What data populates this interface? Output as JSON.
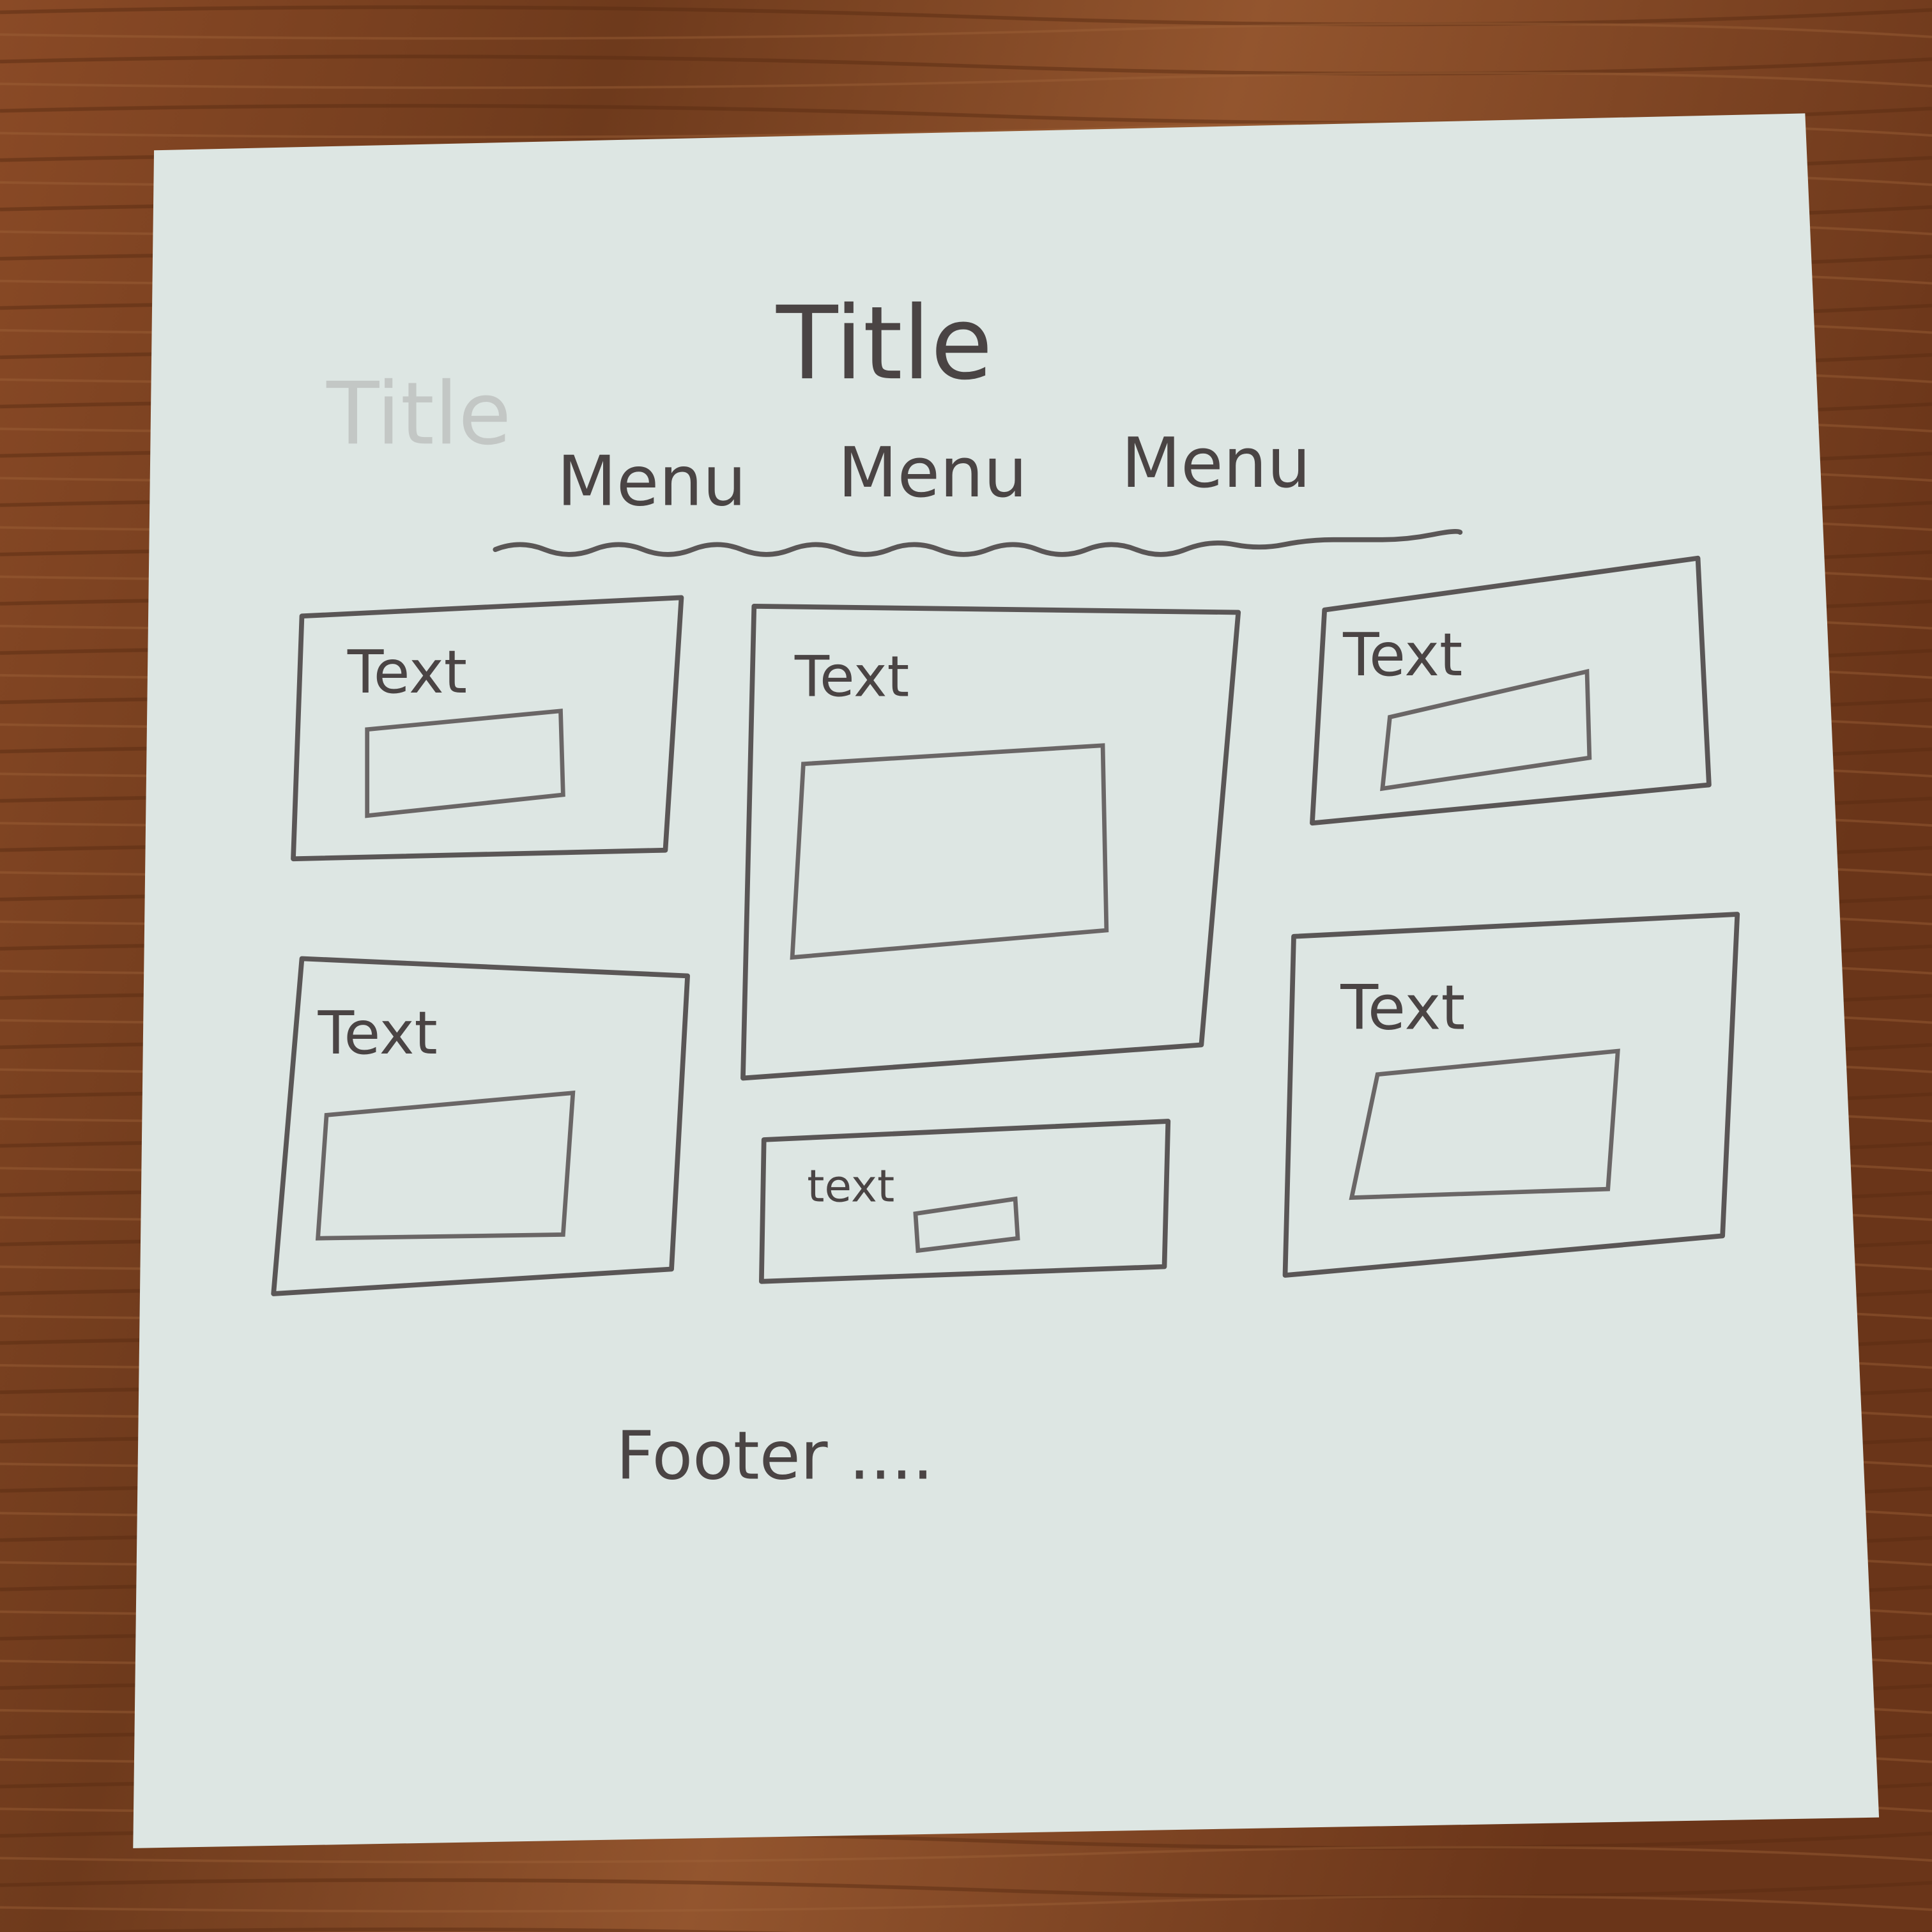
{
  "colors": {
    "paper": "#dde6e3",
    "pencil": "#4a4444",
    "wood": "#7a4122"
  },
  "sketch": {
    "faded_title": "Title",
    "title": "Title",
    "menu": [
      "Menu",
      "Menu",
      "Menu"
    ],
    "cards": [
      {
        "text": "Text"
      },
      {
        "text": "Text"
      },
      {
        "text": "Text"
      },
      {
        "text": "Text"
      },
      {
        "text": "text"
      },
      {
        "text": "Text"
      }
    ],
    "footer": "Footer ...."
  }
}
